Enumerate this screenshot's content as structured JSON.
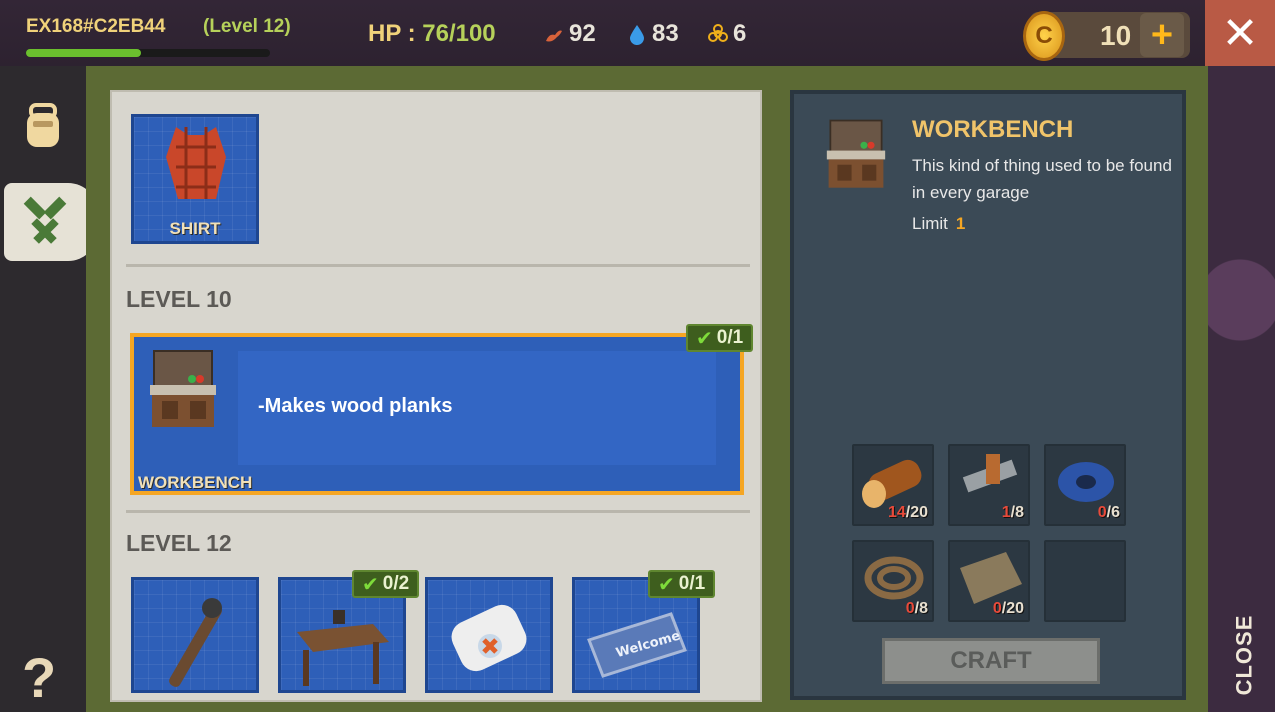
{
  "player": {
    "id": "EX168#C2EB44",
    "level": "(Level 12)",
    "xp_fraction": 0.47
  },
  "stats": {
    "hp_label": "HP :",
    "hp_value": "76/100",
    "food": "92",
    "water": "83",
    "radiation": "6"
  },
  "currency": {
    "coins": "10",
    "plus": "+"
  },
  "close_x": "✕",
  "sections": [
    {
      "title": "LEVEL 10"
    },
    {
      "title": "LEVEL 12"
    }
  ],
  "top_item": {
    "label": "SHIRT"
  },
  "selected_item": {
    "label": "WORKBENCH",
    "badge": "0/1",
    "description": "-Makes wood planks"
  },
  "level12_items": [
    {
      "name": "pipe-tool",
      "badge": ""
    },
    {
      "name": "work-table",
      "badge": "0/2"
    },
    {
      "name": "bandage",
      "badge": ""
    },
    {
      "name": "welcome-mat",
      "badge": "0/1"
    }
  ],
  "detail": {
    "title": "WORKBENCH",
    "description": "This kind of thing used to be found in every garage",
    "limit_label": "Limit",
    "limit_value": "1"
  },
  "resources": [
    {
      "name": "log",
      "have": "14",
      "need": "/20"
    },
    {
      "name": "metal-pipe",
      "have": "1",
      "need": "/8"
    },
    {
      "name": "tape",
      "have": "0",
      "need": "/6"
    },
    {
      "name": "rope",
      "have": "0",
      "need": "/8"
    },
    {
      "name": "cardboard",
      "have": "0",
      "need": "/20"
    }
  ],
  "craft_label": "CRAFT",
  "close_label": "CLOSE",
  "help_label": "?"
}
